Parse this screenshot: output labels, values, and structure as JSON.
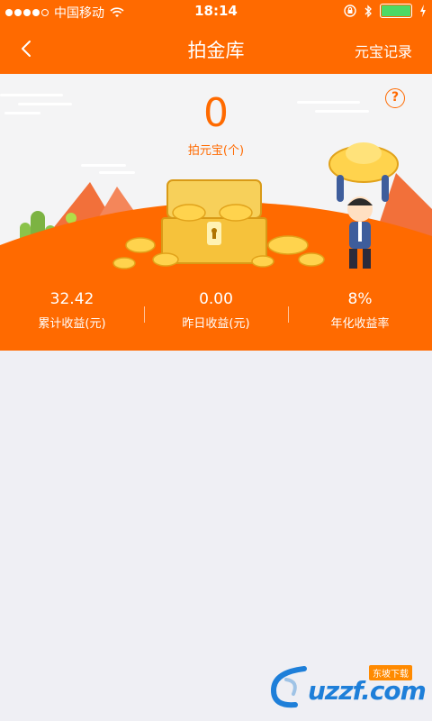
{
  "status": {
    "carrier": "中国移动",
    "time": "18:14"
  },
  "nav": {
    "title": "拍金库",
    "right_link": "元宝记录"
  },
  "summary": {
    "count": "0",
    "count_label": "拍元宝(个)",
    "help": "?"
  },
  "stats": [
    {
      "value": "32.42",
      "label": "累计收益(元)"
    },
    {
      "value": "0.00",
      "label": "昨日收益(元)"
    },
    {
      "value": "8%",
      "label": "年化收益率"
    }
  ],
  "watermark": {
    "text": "uzzf.com",
    "tag": "东坡下载"
  },
  "colors": {
    "brand": "#ff6a00",
    "background": "#efeff4",
    "battery": "#4cd964"
  }
}
